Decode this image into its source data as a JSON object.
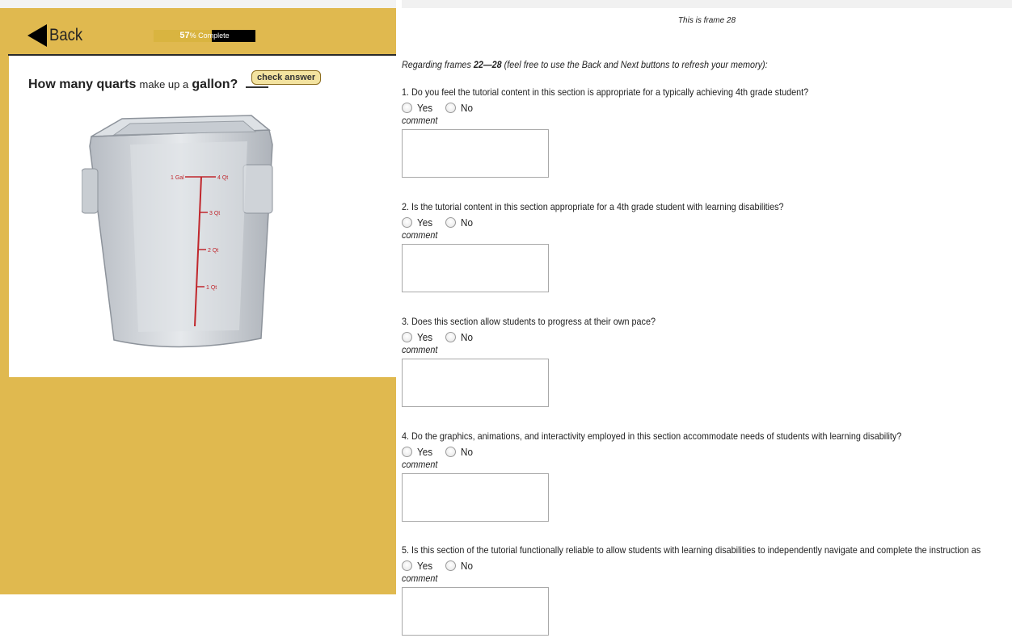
{
  "left": {
    "back_label": "Back",
    "progress": {
      "percent_value": 57,
      "percent": "57",
      "suffix": "% Complete"
    },
    "question": {
      "part1": "How many quarts",
      "part2": "make up a",
      "part3": "gallon?"
    },
    "check_label": "check answer",
    "bucket_marks": [
      "1 Gal",
      "4 Qt",
      "3 Qt",
      "2 Qt",
      "1 Qt"
    ],
    "colors": {
      "panel": "#e0b94f",
      "mark": "#c0262c"
    }
  },
  "survey": {
    "frame_label": "This is frame 28",
    "intro": {
      "pre": "Regarding frames ",
      "range": "22—28",
      "post": " (feel free to use the Back and Next buttons to refresh your memory):"
    },
    "yes_label": "Yes",
    "no_label": "No",
    "comment_label": "comment",
    "questions": [
      {
        "text": "1. Do you feel the tutorial content in this section is appropriate for a typically achieving 4th grade student?"
      },
      {
        "text": "2. Is the tutorial content in this section appropriate for a 4th grade student with learning disabilities?"
      },
      {
        "text": "3. Does this section allow students to progress at their own pace?"
      },
      {
        "text": "4. Do the graphics, animations, and interactivity employed in this section accommodate needs of students with learning disability?"
      },
      {
        "text": "5. Is this section of the tutorial functionally reliable to allow students with learning disabilities to independently navigate and complete the instruction as"
      }
    ]
  }
}
